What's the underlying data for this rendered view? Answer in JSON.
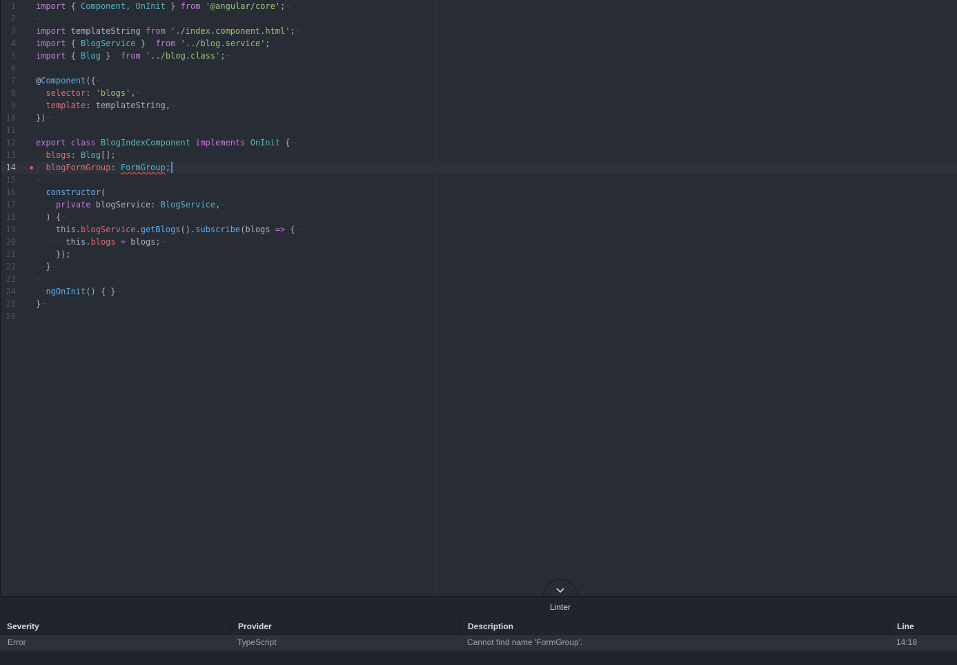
{
  "editor": {
    "cursor_line": 14,
    "lines": [
      {
        "n": "1",
        "t": [
          [
            "kw",
            "import"
          ],
          [
            "pl",
            " { "
          ],
          [
            "cls",
            "Component"
          ],
          [
            "pl",
            ", "
          ],
          [
            "cls",
            "OnInit"
          ],
          [
            "pl",
            " } "
          ],
          [
            "kw",
            "from"
          ],
          [
            "pl",
            " "
          ],
          [
            "str",
            "'@angular/core'"
          ],
          [
            "pl",
            ";"
          ],
          [
            "inv",
            "¬"
          ]
        ]
      },
      {
        "n": "2",
        "t": [
          [
            "inv",
            "¬"
          ]
        ]
      },
      {
        "n": "3",
        "t": [
          [
            "kw",
            "import"
          ],
          [
            "pl",
            " templateString "
          ],
          [
            "kw",
            "from"
          ],
          [
            "pl",
            " "
          ],
          [
            "str",
            "'./index.component.html'"
          ],
          [
            "pl",
            ";"
          ],
          [
            "inv",
            "¬"
          ]
        ]
      },
      {
        "n": "4",
        "t": [
          [
            "kw",
            "import"
          ],
          [
            "pl",
            " { "
          ],
          [
            "cls",
            "BlogService"
          ],
          [
            "pl",
            " }  "
          ],
          [
            "kw",
            "from"
          ],
          [
            "pl",
            " "
          ],
          [
            "str",
            "'../blog.service'"
          ],
          [
            "pl",
            ";"
          ],
          [
            "inv",
            "¬"
          ]
        ]
      },
      {
        "n": "5",
        "t": [
          [
            "kw",
            "import"
          ],
          [
            "pl",
            " { "
          ],
          [
            "cls",
            "Blog"
          ],
          [
            "pl",
            " }  "
          ],
          [
            "kw",
            "from"
          ],
          [
            "pl",
            " "
          ],
          [
            "str",
            "'../blog.class'"
          ],
          [
            "pl",
            ";"
          ],
          [
            "inv",
            "¬"
          ]
        ]
      },
      {
        "n": "6",
        "t": [
          [
            "inv",
            "¬"
          ]
        ]
      },
      {
        "n": "7",
        "t": [
          [
            "pl",
            "@"
          ],
          [
            "fn",
            "Component"
          ],
          [
            "pl",
            "({"
          ],
          [
            "inv",
            "¬"
          ]
        ]
      },
      {
        "n": "8",
        "t": [
          [
            "inv",
            "··"
          ],
          [
            "prop",
            "selector"
          ],
          [
            "pl",
            ": "
          ],
          [
            "str",
            "'blogs'"
          ],
          [
            "pl",
            ","
          ],
          [
            "inv",
            "¬"
          ]
        ]
      },
      {
        "n": "9",
        "t": [
          [
            "inv",
            "··"
          ],
          [
            "prop",
            "template"
          ],
          [
            "pl",
            ": templateString,"
          ],
          [
            "inv",
            "¬"
          ]
        ]
      },
      {
        "n": "10",
        "t": [
          [
            "pl",
            "})"
          ],
          [
            "inv",
            "¬"
          ]
        ]
      },
      {
        "n": "11",
        "t": [
          [
            "inv",
            "¬"
          ]
        ]
      },
      {
        "n": "12",
        "t": [
          [
            "kw",
            "export"
          ],
          [
            "pl",
            " "
          ],
          [
            "kw",
            "class"
          ],
          [
            "pl",
            " "
          ],
          [
            "cls",
            "BlogIndexComponent"
          ],
          [
            "pl",
            " "
          ],
          [
            "kw",
            "implements"
          ],
          [
            "pl",
            " "
          ],
          [
            "cls",
            "OnInit"
          ],
          [
            "pl",
            " {"
          ],
          [
            "inv",
            "¬"
          ]
        ]
      },
      {
        "n": "13",
        "t": [
          [
            "inv",
            "··"
          ],
          [
            "prop",
            "blogs"
          ],
          [
            "pl",
            ": "
          ],
          [
            "cls",
            "Blog"
          ],
          [
            "pl",
            "[];"
          ],
          [
            "inv",
            "¬"
          ]
        ]
      },
      {
        "n": "14",
        "t": [
          [
            "inv",
            "··"
          ],
          [
            "prop",
            "blogFormGroup"
          ],
          [
            "pl",
            ": "
          ],
          [
            "err",
            "FormGroup"
          ],
          [
            "pl",
            ";"
          ]
        ]
      },
      {
        "n": "15",
        "t": [
          [
            "inv",
            "¬"
          ]
        ]
      },
      {
        "n": "16",
        "t": [
          [
            "inv",
            "··"
          ],
          [
            "fn",
            "constructor"
          ],
          [
            "pl",
            "("
          ],
          [
            "inv",
            "¬"
          ]
        ]
      },
      {
        "n": "17",
        "t": [
          [
            "inv",
            "····"
          ],
          [
            "kw",
            "private"
          ],
          [
            "pl",
            " blogService: "
          ],
          [
            "cls",
            "BlogService"
          ],
          [
            "pl",
            ","
          ],
          [
            "inv",
            "¬"
          ]
        ]
      },
      {
        "n": "18",
        "t": [
          [
            "inv",
            "··"
          ],
          [
            "pl",
            ") {"
          ],
          [
            "inv",
            "¬"
          ]
        ]
      },
      {
        "n": "19",
        "t": [
          [
            "inv",
            "····"
          ],
          [
            "pl",
            "this."
          ],
          [
            "prop",
            "blogService"
          ],
          [
            "pl",
            "."
          ],
          [
            "fn",
            "getBlogs"
          ],
          [
            "pl",
            "()."
          ],
          [
            "fn",
            "subscribe"
          ],
          [
            "pl",
            "(blogs "
          ],
          [
            "kw",
            "=>"
          ],
          [
            "pl",
            " {"
          ],
          [
            "inv",
            "¬"
          ]
        ]
      },
      {
        "n": "20",
        "t": [
          [
            "inv",
            "······"
          ],
          [
            "pl",
            "this."
          ],
          [
            "prop",
            "blogs"
          ],
          [
            "pl",
            " "
          ],
          [
            "kw",
            "="
          ],
          [
            "pl",
            " blogs;"
          ],
          [
            "inv",
            "¬"
          ]
        ]
      },
      {
        "n": "21",
        "t": [
          [
            "inv",
            "····"
          ],
          [
            "pl",
            "});"
          ],
          [
            "inv",
            "¬"
          ]
        ]
      },
      {
        "n": "22",
        "t": [
          [
            "inv",
            "··"
          ],
          [
            "pl",
            "}"
          ],
          [
            "inv",
            "¬"
          ]
        ]
      },
      {
        "n": "23",
        "t": [
          [
            "inv",
            "¬"
          ]
        ]
      },
      {
        "n": "24",
        "t": [
          [
            "inv",
            "··"
          ],
          [
            "fn",
            "ngOnInit"
          ],
          [
            "pl",
            "() { }"
          ],
          [
            "inv",
            "¬"
          ]
        ]
      },
      {
        "n": "25",
        "t": [
          [
            "pl",
            "}"
          ],
          [
            "inv",
            "¬"
          ]
        ]
      },
      {
        "n": "26",
        "t": []
      }
    ]
  },
  "linter": {
    "title": "Linter",
    "columns": [
      "Severity",
      "Provider",
      "Description",
      "Line"
    ],
    "rows": [
      {
        "severity": "Error",
        "provider": "TypeScript",
        "description": "Cannot find name 'FormGroup'.",
        "line": "14:18"
      }
    ]
  },
  "colors": {
    "error_marker": "#e05252",
    "cursor": "#528bff",
    "keyword": "#c678dd",
    "string": "#98c379",
    "class": "#56b6c2",
    "function": "#61afef",
    "property": "#e06c75"
  }
}
